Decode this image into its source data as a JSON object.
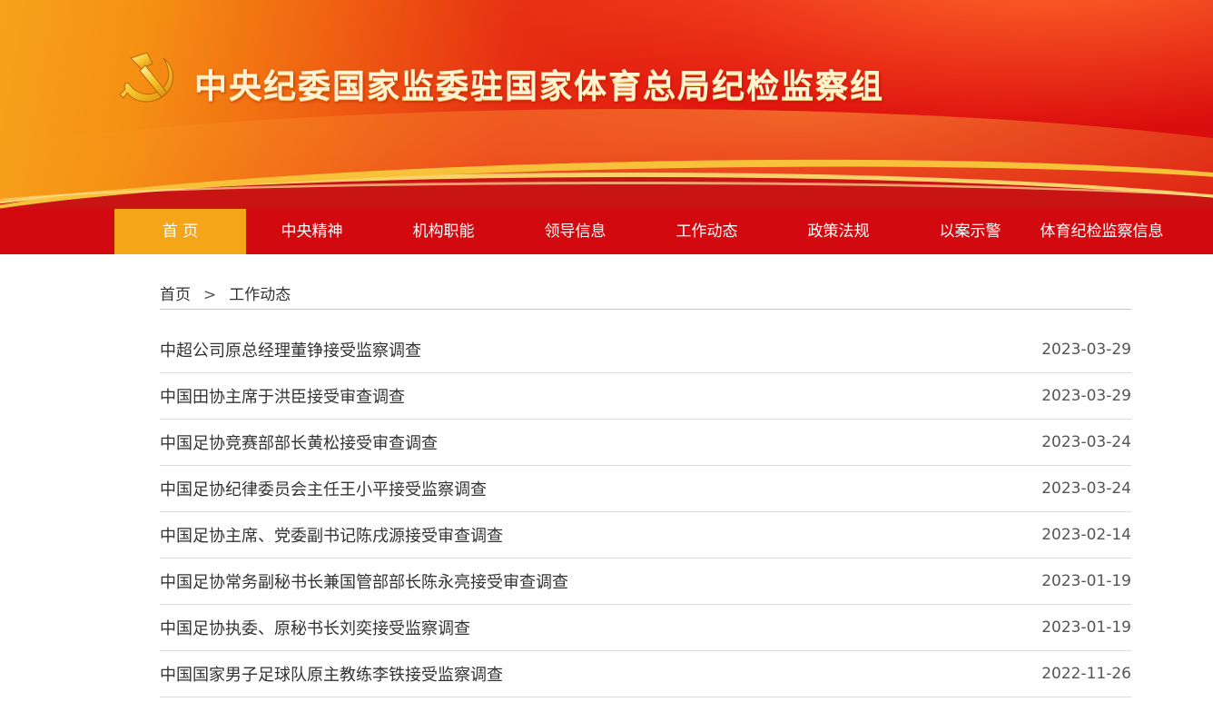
{
  "header": {
    "title": "中央纪委国家监委驻国家体育总局纪检监察组",
    "emblem_icon": "party-emblem-icon",
    "colors": {
      "red": "#d2090f",
      "gold": "#f4a518"
    }
  },
  "nav": {
    "items": [
      {
        "label": "首 页",
        "active": true
      },
      {
        "label": "中央精神"
      },
      {
        "label": "机构职能"
      },
      {
        "label": "领导信息"
      },
      {
        "label": "工作动态"
      },
      {
        "label": "政策法规"
      },
      {
        "label": "以案示警"
      },
      {
        "label": "体育纪检监察信息"
      }
    ]
  },
  "breadcrumb": {
    "home": "首页",
    "separator": ">",
    "current": "工作动态"
  },
  "articles": [
    {
      "title": "中超公司原总经理董铮接受监察调查",
      "date": "2023-03-29"
    },
    {
      "title": "中国田协主席于洪臣接受审查调查",
      "date": "2023-03-29"
    },
    {
      "title": "中国足协竞赛部部长黄松接受审查调查",
      "date": "2023-03-24"
    },
    {
      "title": "中国足协纪律委员会主任王小平接受监察调查",
      "date": "2023-03-24"
    },
    {
      "title": "中国足协主席、党委副书记陈戌源接受审查调查",
      "date": "2023-02-14"
    },
    {
      "title": "中国足协常务副秘书长兼国管部部长陈永亮接受审查调查",
      "date": "2023-01-19"
    },
    {
      "title": "中国足协执委、原秘书长刘奕接受监察调查",
      "date": "2023-01-19"
    },
    {
      "title": "中国国家男子足球队原主教练李铁接受监察调查",
      "date": "2022-11-26"
    }
  ]
}
